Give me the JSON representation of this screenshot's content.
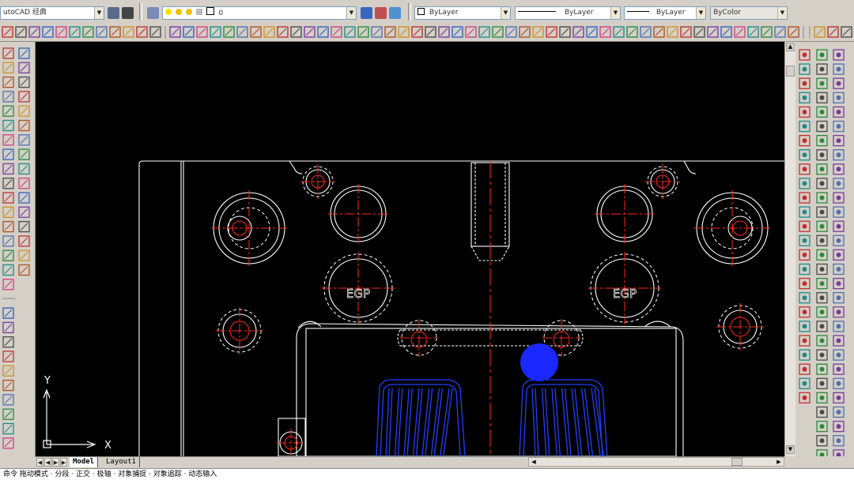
{
  "workspace": {
    "label": "AutoCAD 经典",
    "value": "utoCAD 经典"
  },
  "layer": {
    "current": "0"
  },
  "properties": {
    "color": "ByLayer",
    "linetype": "ByLayer",
    "lineweight": "ByLayer",
    "plotstyle": "ByColor"
  },
  "drawing": {
    "label_left": "EGP",
    "label_right": "EGP",
    "ucs_y": "Y",
    "ucs_x": "X"
  },
  "tabs": [
    {
      "label": "Model",
      "active": true
    },
    {
      "label": "Layout1",
      "active": false
    }
  ],
  "command_line": {
    "text": "命令 拖动模式 · 分段 · 正交 · 极轴 · 对象捕捉 · 对象追踪 · 动态输入"
  },
  "colors": {
    "canvas": "#000000",
    "white_lines": "#ffffff",
    "red_center": "#ff2a1a",
    "blue_part": "#2040ff",
    "blue_circle": "#1a28ff",
    "chrome": "#d4d0c8"
  }
}
